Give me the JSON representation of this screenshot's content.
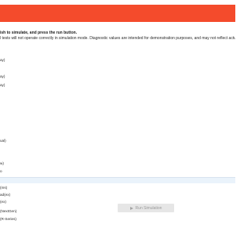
{
  "header": {
    "accent": "#f44b2c"
  },
  "instructions": {
    "line1": "ish to simulate, and press the run button.",
    "line2": "l tests will not operate correctly in simulation mode. Diagnostic values are intended for demonstration purposes, and may not reflect actual machine operation."
  },
  "options": [
    "ay)",
    "ay)",
    "ay)",
    "ual)",
    "w)",
    "o",
    "(ms)",
    "ad(ex)",
    "(ex)",
    "(NextGen)",
    "(R-Series)"
  ],
  "run_button": {
    "label": "Run Simulation",
    "icon": "play-icon",
    "state": "disabled"
  }
}
